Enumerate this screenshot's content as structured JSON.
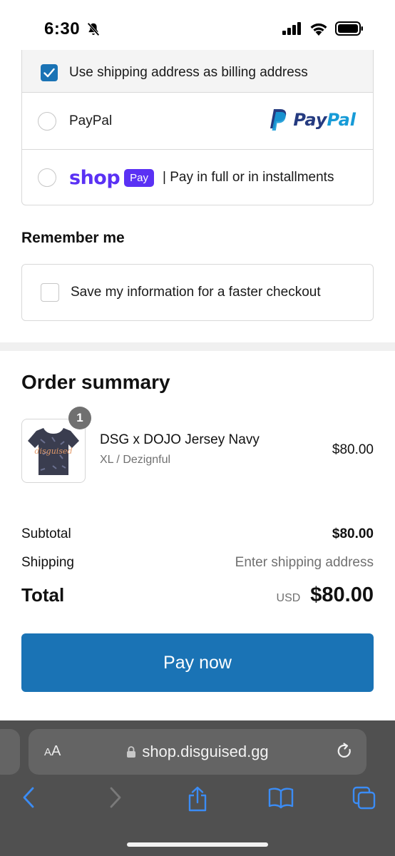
{
  "status_bar": {
    "time": "6:30"
  },
  "payment": {
    "billing_label": "Use shipping address as billing address",
    "paypal_label": "PayPal",
    "paypal_logo_pay": "Pay",
    "paypal_logo_pal": "Pal",
    "shop_logo_word": "shop",
    "shop_logo_badge": "Pay",
    "shop_description": "| Pay in full or in installments"
  },
  "remember": {
    "title": "Remember me",
    "save_label": "Save my information for a faster checkout"
  },
  "order_summary": {
    "title": "Order summary",
    "product": {
      "quantity": "1",
      "name": "DSG x DOJO Jersey Navy",
      "variant": "XL / Dezignful",
      "price": "$80.00",
      "jersey_text": "disguised"
    },
    "subtotal_label": "Subtotal",
    "subtotal_value": "$80.00",
    "shipping_label": "Shipping",
    "shipping_value": "Enter shipping address",
    "total_label": "Total",
    "total_currency": "USD",
    "total_value": "$80.00"
  },
  "pay_button": "Pay now",
  "browser": {
    "aa_small": "A",
    "aa_large": "A",
    "url": "shop.disguised.gg"
  },
  "colors": {
    "accent_blue": "#1a73b5",
    "shop_purple": "#5a31f4",
    "paypal_dark": "#253b80",
    "paypal_light": "#179bd7"
  }
}
